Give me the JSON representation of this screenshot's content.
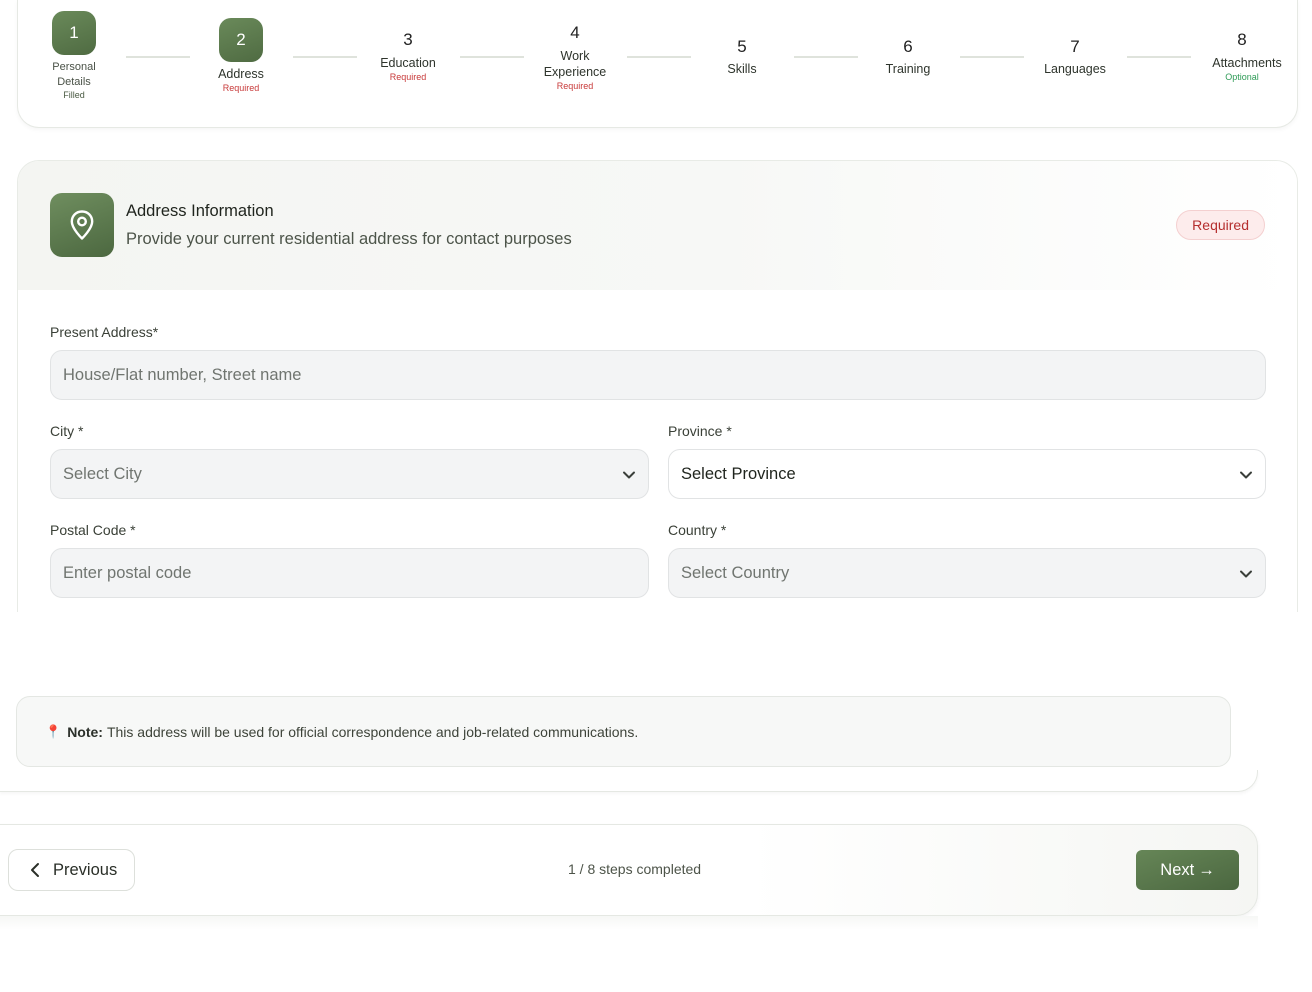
{
  "stepper": {
    "steps": [
      {
        "number": "1",
        "label": "Personal Details",
        "status": "Filled"
      },
      {
        "number": "2",
        "label": "Address",
        "status": "Required"
      },
      {
        "number": "3",
        "label": "Education",
        "status": "Required"
      },
      {
        "number": "4",
        "label": "Work Experience",
        "status": "Required"
      },
      {
        "number": "5",
        "label": "Skills",
        "status": ""
      },
      {
        "number": "6",
        "label": "Training",
        "status": ""
      },
      {
        "number": "7",
        "label": "Languages",
        "status": ""
      },
      {
        "number": "8",
        "label": "Attachments",
        "status": "Optional"
      }
    ]
  },
  "section": {
    "title": "Address Information",
    "subtitle": "Provide your current residential address for contact purposes",
    "badge": "Required",
    "icon": "map-pin-icon"
  },
  "form": {
    "present_address": {
      "label": "Present Address*",
      "placeholder": "House/Flat number, Street name"
    },
    "city": {
      "label": "City *",
      "value": "Select City"
    },
    "province": {
      "label": "Province *",
      "value": "Select Province"
    },
    "postal_code": {
      "label": "Postal Code *",
      "placeholder": "Enter postal code"
    },
    "country": {
      "label": "Country *",
      "value": "Select Country"
    }
  },
  "note": {
    "icon": "📍",
    "bold": "Note:",
    "text": "This address will be used for official correspondence and job-related communications."
  },
  "nav": {
    "previous_label": "Previous",
    "progress_text": "1 / 8 steps completed",
    "next_label": "Next",
    "next_arrow": "→"
  },
  "colors": {
    "accent": "#5d7a4f",
    "required": "#c83a3a",
    "optional": "#2f9b57"
  }
}
